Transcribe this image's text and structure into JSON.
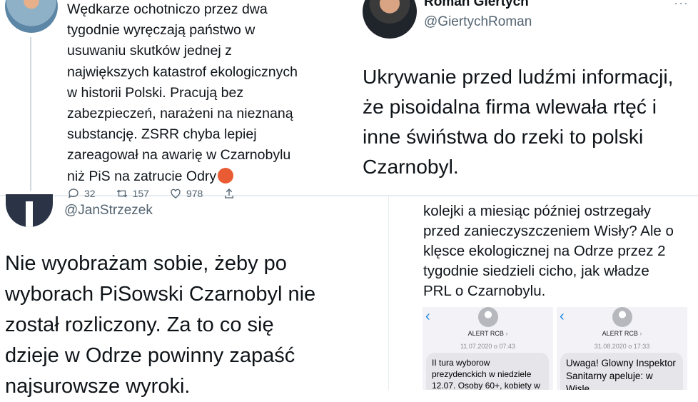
{
  "tweet1": {
    "text_lines": [
      "Wędkarze ochotniczo przez dwa",
      "tygodnie wyręczają państwo w",
      "usuwaniu skutków jednej z",
      "największych katastrof ekologicznych",
      "w historii Polski. Pracują bez",
      "zabezpieczeń, narażeni na nieznaną",
      "substancję. ZSRR chyba lepiej",
      "zareagował na awarię w Czarnobylu",
      "niż PiS na zatrucie Odry"
    ],
    "emoji_icon": "angry-face-emoji",
    "reply_count": "32",
    "retweet_count": "157",
    "like_count": "978"
  },
  "tweet2": {
    "author_name": "Roman Giertych",
    "handle": "@GiertychRoman",
    "more": "···",
    "text_lines": [
      "Ukrywanie przed ludźmi informacji,",
      "że pisoidalna firma wlewała rtęć i",
      "inne świństwa do rzeki to polski",
      "Czarnobyl."
    ]
  },
  "tweet3": {
    "handle": "@JanStrzezek",
    "text_lines": [
      "Nie wyobrażam sobie, żeby po",
      "wyborach PiSowski Czarnobyl nie",
      "został rozliczony. Za to co się",
      "dzieje w Odrze powinny zapaść",
      "najsurowsze wyroki."
    ]
  },
  "tweet4": {
    "text_lines": [
      "kolejki a miesiąc później ostrzegały",
      "przed zanieczyszczeniem Wisły? Ale o",
      "klęsce ekologicznej na Odrze przez 2",
      "tygodnie siedzieli cicho, jak władze",
      "PRL o Czarnobylu."
    ],
    "sms": [
      {
        "contact": "ALERT RCB",
        "date": "11.07.2020 o 07:43",
        "message": "II tura wyborow prezydenckich w niedziele 12.07. Osoby 60+, kobiety w"
      },
      {
        "contact": "ALERT RCB",
        "date": "31.08.2020 o 17:33",
        "message": "Uwaga! Glowny Inspektor Sanitarny apeluje: w Wisle,"
      }
    ]
  },
  "colors": {
    "text": "#0f1419",
    "secondary": "#536471",
    "ios_link": "#1e88e5",
    "sms_bg": "#f2f2f7",
    "bubble": "#e5e5ea"
  }
}
